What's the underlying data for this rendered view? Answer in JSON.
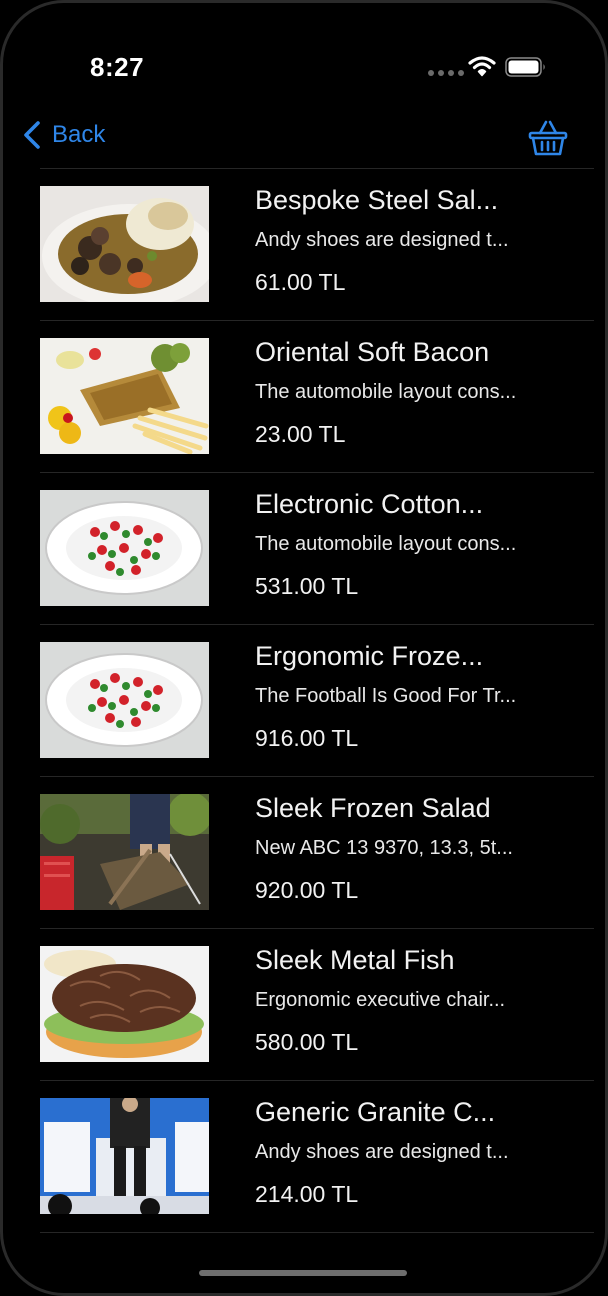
{
  "status_bar": {
    "time": "8:27"
  },
  "nav": {
    "back_label": "Back",
    "back_icon": "chevron-left-icon",
    "basket_icon": "basket-icon",
    "accent_color": "#2f86e8"
  },
  "products": [
    {
      "title": "Bespoke Steel Sal...",
      "description": "Andy shoes are designed t...",
      "price": "61.00 TL",
      "image": "food-photo-stew"
    },
    {
      "title": "Oriental Soft Bacon",
      "description": "The automobile layout cons...",
      "price": "23.00 TL",
      "image": "food-photo-fish-fries"
    },
    {
      "title": "Electronic Cotton...",
      "description": "The automobile layout cons...",
      "price": "531.00 TL",
      "image": "food-photo-salad-plate"
    },
    {
      "title": "Ergonomic Froze...",
      "description": "The Football Is Good For Tr...",
      "price": "916.00 TL",
      "image": "food-photo-salad-plate"
    },
    {
      "title": "Sleek Frozen Salad",
      "description": "New ABC 13 9370, 13.3, 5t...",
      "price": "920.00 TL",
      "image": "photo-garden-digging"
    },
    {
      "title": "Sleek Metal Fish",
      "description": "Ergonomic executive chair...",
      "price": "580.00 TL",
      "image": "food-photo-burger"
    },
    {
      "title": "Generic Granite C...",
      "description": "Andy shoes are designed t...",
      "price": "214.00 TL",
      "image": "photo-conference-stage"
    }
  ]
}
